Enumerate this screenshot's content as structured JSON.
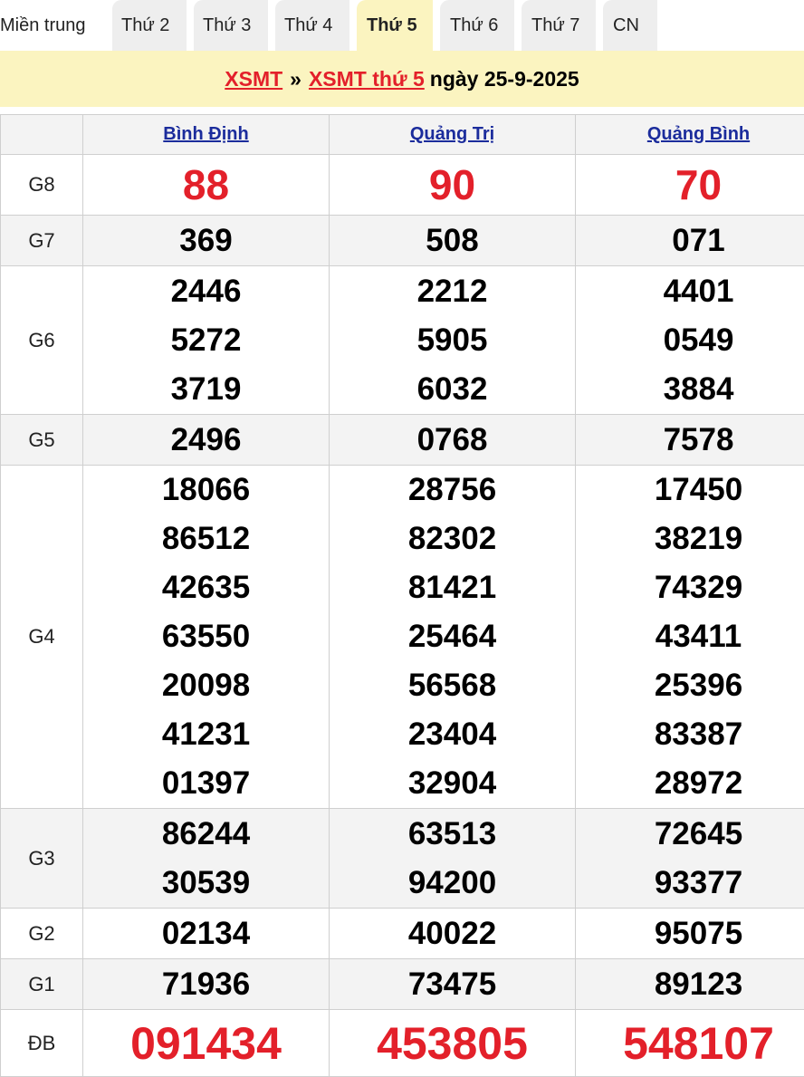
{
  "tabs": [
    {
      "label": "Miền trung",
      "active": false
    },
    {
      "label": "Thứ 2",
      "active": false
    },
    {
      "label": "Thứ 3",
      "active": false
    },
    {
      "label": "Thứ 4",
      "active": false
    },
    {
      "label": "Thứ 5",
      "active": true
    },
    {
      "label": "Thứ 6",
      "active": false
    },
    {
      "label": "Thứ 7",
      "active": false
    },
    {
      "label": "CN",
      "active": false
    }
  ],
  "banner": {
    "link1": "XSMT",
    "separator": "»",
    "link2": "XSMT thứ 5",
    "date": "ngày 25-9-2025"
  },
  "table": {
    "provinces": [
      "Bình Định",
      "Quảng Trị",
      "Quảng Bình"
    ],
    "rows": [
      {
        "label": "G8",
        "values": [
          [
            "88"
          ],
          [
            "90"
          ],
          [
            "70"
          ]
        ]
      },
      {
        "label": "G7",
        "values": [
          [
            "369"
          ],
          [
            "508"
          ],
          [
            "071"
          ]
        ]
      },
      {
        "label": "G6",
        "values": [
          [
            "2446",
            "5272",
            "3719"
          ],
          [
            "2212",
            "5905",
            "6032"
          ],
          [
            "4401",
            "0549",
            "3884"
          ]
        ]
      },
      {
        "label": "G5",
        "values": [
          [
            "2496"
          ],
          [
            "0768"
          ],
          [
            "7578"
          ]
        ]
      },
      {
        "label": "G4",
        "values": [
          [
            "18066",
            "86512",
            "42635",
            "63550",
            "20098",
            "41231",
            "01397"
          ],
          [
            "28756",
            "82302",
            "81421",
            "25464",
            "56568",
            "23404",
            "32904"
          ],
          [
            "17450",
            "38219",
            "74329",
            "43411",
            "25396",
            "83387",
            "28972"
          ]
        ]
      },
      {
        "label": "G3",
        "values": [
          [
            "86244",
            "30539"
          ],
          [
            "63513",
            "94200"
          ],
          [
            "72645",
            "93377"
          ]
        ]
      },
      {
        "label": "G2",
        "values": [
          [
            "02134"
          ],
          [
            "40022"
          ],
          [
            "95075"
          ]
        ]
      },
      {
        "label": "G1",
        "values": [
          [
            "71936"
          ],
          [
            "73475"
          ],
          [
            "89123"
          ]
        ]
      },
      {
        "label": "ĐB",
        "values": [
          [
            "091434"
          ],
          [
            "453805"
          ],
          [
            "548107"
          ]
        ]
      }
    ]
  },
  "colors": {
    "accent_red": "#e3202a",
    "link_blue": "#1b2c9c",
    "banner_bg": "#fbf4c0",
    "tab_bg": "#eeeeee"
  }
}
